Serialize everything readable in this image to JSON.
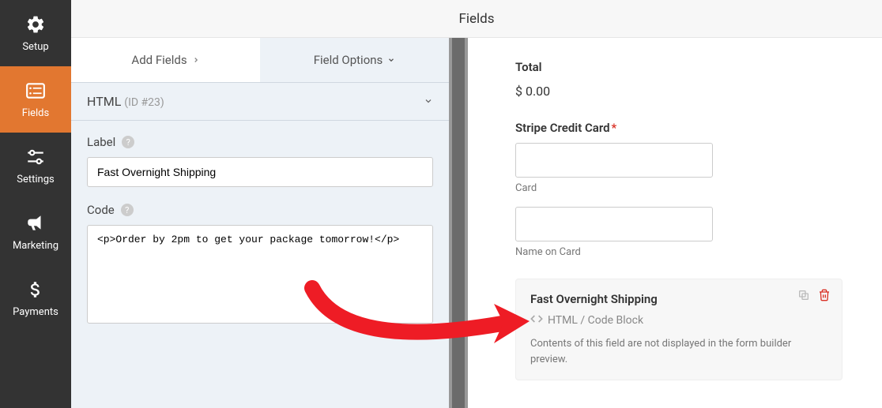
{
  "header": {
    "title": "Fields"
  },
  "sidebar": {
    "items": [
      {
        "label": "Setup"
      },
      {
        "label": "Fields"
      },
      {
        "label": "Settings"
      },
      {
        "label": "Marketing"
      },
      {
        "label": "Payments"
      }
    ]
  },
  "tabs": {
    "add_fields": "Add Fields",
    "field_options": "Field Options"
  },
  "field": {
    "name": "HTML",
    "id_label": "(ID #23)",
    "label_text": "Label",
    "label_value": "Fast Overnight Shipping",
    "code_text": "Code",
    "code_value": "<p>Order by 2pm to get your package tomorrow!</p>"
  },
  "preview": {
    "total_label": "Total",
    "total_value": "$ 0.00",
    "stripe_label": "Stripe Credit Card",
    "card_label": "Card",
    "name_label": "Name on Card",
    "html_block": {
      "title": "Fast Overnight Shipping",
      "type": "HTML / Code Block",
      "desc": "Contents of this field are not displayed in the form builder preview."
    }
  }
}
